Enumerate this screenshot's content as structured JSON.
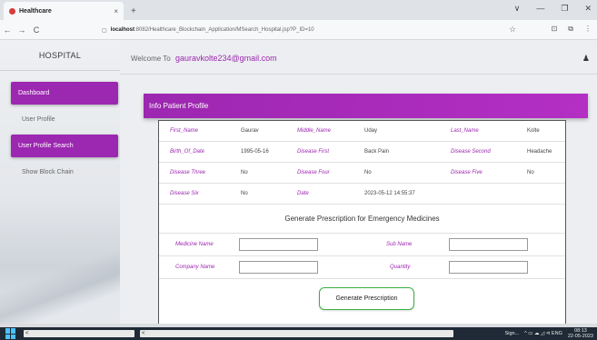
{
  "browser": {
    "tab_title": "Healthcare",
    "tab_close": "×",
    "new_tab": "+",
    "win_controls": [
      "∨",
      "—",
      "❐",
      "✕"
    ],
    "nav_back": "←",
    "nav_forward": "→",
    "nav_reload": "C",
    "url_host": "localhost",
    "url_path": ":8082/Healthcare_Blockchain_Application/MSearch_Hospital.jsp?P_ID=10",
    "star_icon": "☆",
    "tools": [
      "⊡",
      "⧉",
      "⋮"
    ]
  },
  "sidebar": {
    "brand": "HOSPITAL",
    "items": [
      {
        "label": "Dashboard",
        "active": true
      },
      {
        "label": "User Profile",
        "active": false
      },
      {
        "label": "User Profile Search",
        "active": true
      },
      {
        "label": "Show Block Chain",
        "active": false
      }
    ]
  },
  "header": {
    "welcome": "Welcome To",
    "email": "gauravkolte234@gmail.com",
    "user_icon": "♟"
  },
  "card": {
    "title": "Info Patient Profile"
  },
  "profile": {
    "rows": [
      [
        {
          "label": "First_Name",
          "value": "Gaurav"
        },
        {
          "label": "Middle_Name",
          "value": "Uday"
        },
        {
          "label": "Last_Name",
          "value": "Kolte"
        }
      ],
      [
        {
          "label": "Birth_Of_Date",
          "value": "1995-05-16"
        },
        {
          "label": "Disease First",
          "value": "Back Pain"
        },
        {
          "label": "Disease Second",
          "value": "Headache"
        }
      ],
      [
        {
          "label": "Disease Three",
          "value": "No"
        },
        {
          "label": "Disease Four",
          "value": "No"
        },
        {
          "label": "Disease Five",
          "value": "No"
        }
      ],
      [
        {
          "label": "Disease Six",
          "value": "No"
        },
        {
          "label": "Date",
          "value": "2023-05-12 14:55:37"
        }
      ]
    ]
  },
  "prescription": {
    "title": "Generate Prescription for Emergency Medicines",
    "medicine_name_label": "Medicine Name",
    "sub_name_label": "Sub Name",
    "company_name_label": "Company Name",
    "quantity_label": "Quantity",
    "medicine_name_value": "",
    "sub_name_value": "",
    "company_name_value": "",
    "quantity_value": "",
    "button_label": "Generate Prescription"
  },
  "taskbar": {
    "left_arrow": "<",
    "mid_arrow": "<",
    "tray": "^ ▭ ☁ ◿ ⊲ ENG",
    "search_hint": "Sign...",
    "time": "08:13",
    "date": "22-05-2023"
  }
}
